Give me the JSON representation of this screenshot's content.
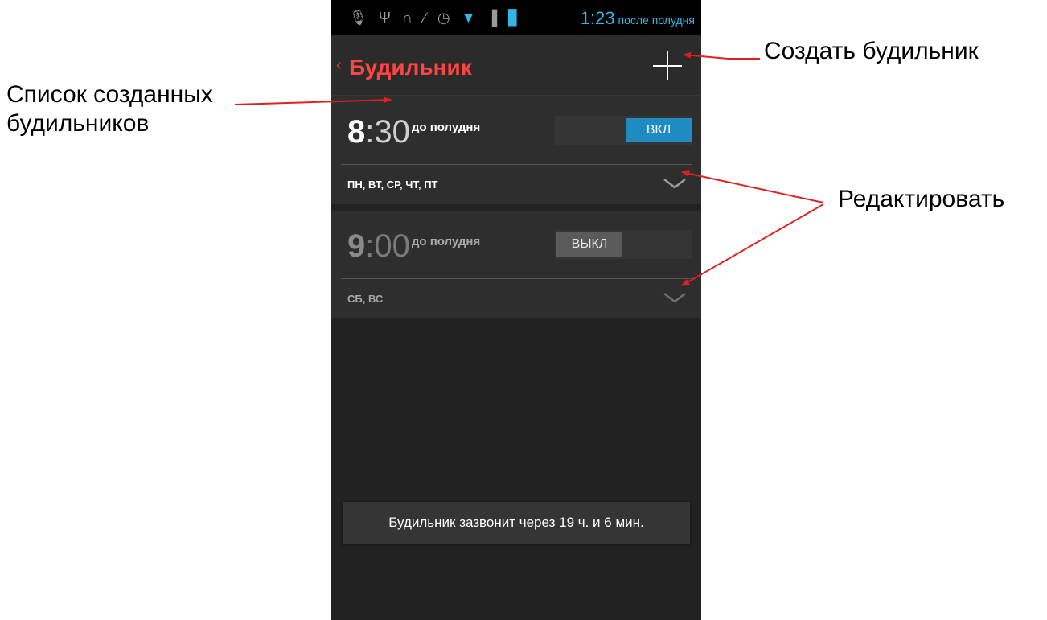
{
  "statusbar": {
    "time": "1:23",
    "ampm": "после полудня",
    "icons": [
      "microphone-icon",
      "usb-icon",
      "headphones-icon",
      "mute-icon",
      "alarm-clock-icon",
      "wifi-icon",
      "signal-icon",
      "battery-icon"
    ],
    "accent_color": "#33b5e5"
  },
  "actionbar": {
    "title": "Будильник",
    "title_color": "#ff4444",
    "back_icon": "back-chevron-icon",
    "add_icon": "plus-icon"
  },
  "alarms": [
    {
      "hour": "8",
      "minutes": ":30",
      "ampm": "до полудня",
      "toggle_label": "ВКЛ",
      "enabled": true,
      "days": "ПН, ВТ, СР, ЧТ, ПТ"
    },
    {
      "hour": "9",
      "minutes": ":00",
      "ampm": "до полудня",
      "toggle_label": "ВЫКЛ",
      "enabled": false,
      "days": "СБ, ВС"
    }
  ],
  "toast": "Будильник зазвонит через 19 ч. и 6 мин.",
  "callouts": {
    "list": "Список созданных будильников",
    "create": "Создать будильник",
    "edit": "Редактировать",
    "arrow_color": "#e02020"
  }
}
